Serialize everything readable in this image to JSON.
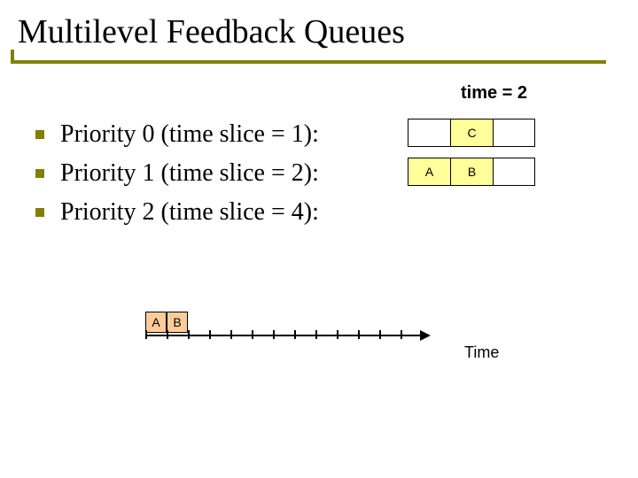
{
  "title": "Multilevel Feedback Queues",
  "time_label": "time = 2",
  "bullets": [
    "Priority 0 (time slice = 1):",
    "Priority 1 (time slice = 2):",
    "Priority 2 (time slice = 4):"
  ],
  "queues": {
    "row0": [
      "",
      "C",
      ""
    ],
    "row1": [
      "A",
      "B",
      ""
    ]
  },
  "timeline": {
    "slots": [
      "A",
      "B"
    ],
    "axis_label": "Time"
  }
}
